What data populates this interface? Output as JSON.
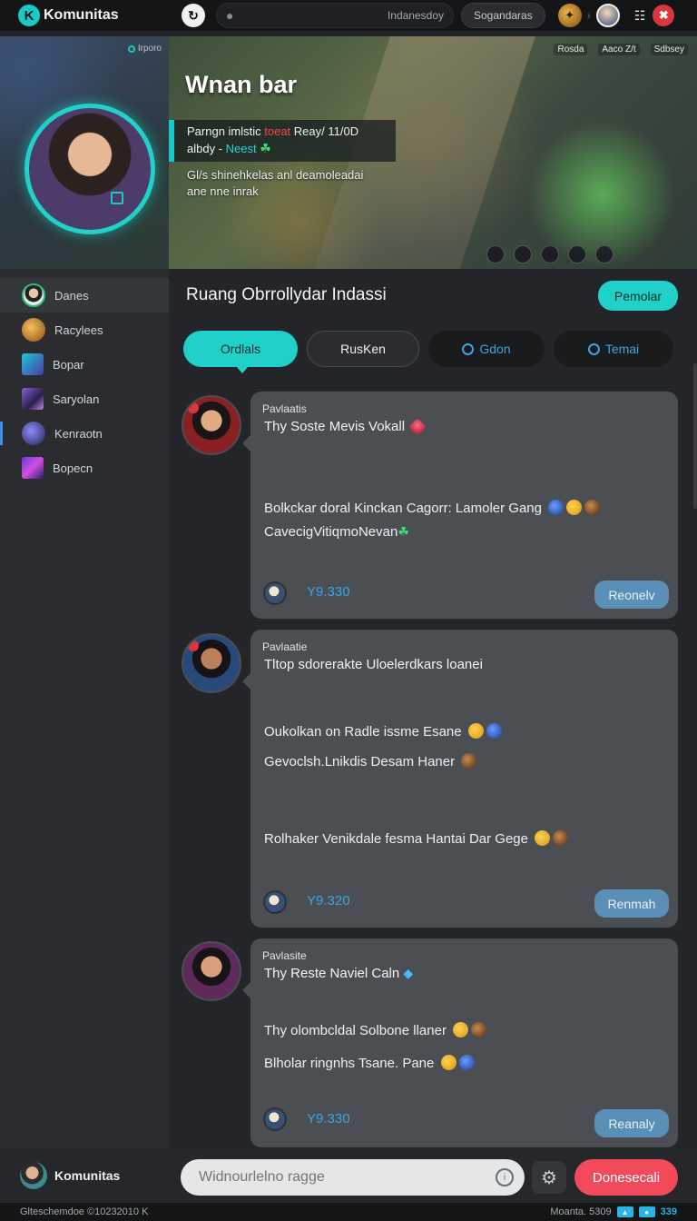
{
  "app": {
    "name": "Komunitas",
    "logo_letter": "K"
  },
  "topbar": {
    "search_value": "Indanesdoy",
    "pill_label": "Sogandaras",
    "grid_icon": "grid-icon",
    "close_icon": "close-icon"
  },
  "sidebar": {
    "online_label": "Irporo",
    "items": [
      {
        "label": "Danes"
      },
      {
        "label": "Racylees"
      },
      {
        "label": "Bopar"
      },
      {
        "label": "Saryolan"
      },
      {
        "label": "Kenraotn"
      },
      {
        "label": "Bopecn"
      }
    ]
  },
  "banner": {
    "title": "Wnan bar",
    "box_line1_a": "Parngn imlstic ",
    "box_line1_red": "toeat",
    "box_line1_b": " Reay/ 11/0D",
    "box_line2_a": "albdy - ",
    "box_line2_cyan": "Neest",
    "desc_line1": "Gl/s shinehkelas anl deamoleadai",
    "desc_line2": "ane nne inrak",
    "stats": [
      "Rosda",
      "Aaco Z/t",
      "Sdbsey"
    ]
  },
  "room": {
    "title": "Ruang Obrrollydar Indassi",
    "join_label": "Pemolar",
    "tabs": [
      {
        "label": "Ordlals"
      },
      {
        "label": "RusKen"
      },
      {
        "label": "Gdon"
      },
      {
        "label": "Temai"
      }
    ]
  },
  "posts": [
    {
      "user": "Pavlaatis",
      "heading": "Thy Soste Mevis Vokall",
      "lines": [
        "Bolkckar doral Kinckan Cagorr: Lamoler Gang",
        "CavecigVitiqmoNevan"
      ],
      "count": "Y9.330",
      "action": "Reonelv"
    },
    {
      "user": "Pavlaatie",
      "heading": "Tltop sdorerakte Uloelerdkars loanei",
      "lines": [
        "Oukolkan on Radle issme Esane",
        "Gevoclsh.Lnikdis Desam Haner",
        "Rolhaker Venikdale fesma Hantai Dar Gege"
      ],
      "count": "Y9.320",
      "action": "Renmah"
    },
    {
      "user": "Pavlasite",
      "heading": "Thy Reste Naviel Caln",
      "lines": [
        "Thy olombcldal Solbone llaner",
        "Blholar ringnhs Tsane. Pane"
      ],
      "count": "Y9.330",
      "action": "Reanaly"
    }
  ],
  "bottombar": {
    "brand": "Komunitas",
    "input_placeholder": "Widnourlelno ragge",
    "send_label": "Donesecali"
  },
  "statusbar": {
    "left": "Glteschemdoe ©10232010 K",
    "right": "Moanta. 5309",
    "num": "339"
  },
  "colors": {
    "accent": "#1fd1c8",
    "send": "#f24a5a",
    "link": "#3aa6e6",
    "post_bg": "#4b4e53",
    "reply_btn": "#5a8fb8"
  }
}
